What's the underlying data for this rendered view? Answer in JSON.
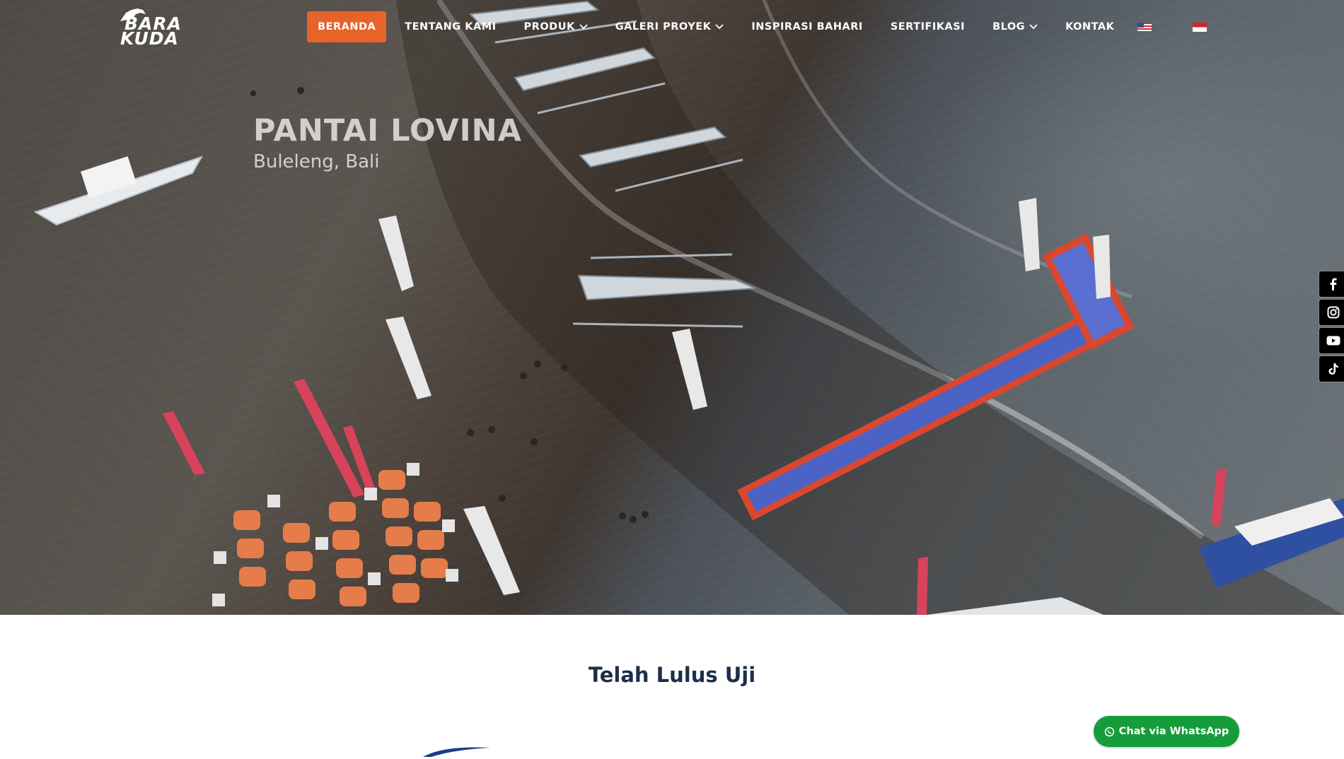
{
  "brand": {
    "logo_line1": "BARA",
    "logo_line2": "KUDA"
  },
  "nav": {
    "items": [
      {
        "label": "BERANDA",
        "active": true
      },
      {
        "label": "TENTANG KAMI"
      },
      {
        "label": "PRODUK",
        "dropdown": true
      },
      {
        "label": "GALERI PROYEK",
        "dropdown": true
      },
      {
        "label": "INSPIRASI BAHARI"
      },
      {
        "label": "SERTIFIKASI"
      },
      {
        "label": "BLOG",
        "dropdown": true
      },
      {
        "label": "KONTAK"
      }
    ],
    "languages": [
      "en-flag-icon",
      "id-flag-icon"
    ],
    "active_color": "#e8632a"
  },
  "hero": {
    "place": "PANTAI LOVINA",
    "region": "Buleleng, Bali"
  },
  "social": {
    "icons": [
      "facebook-icon",
      "instagram-icon",
      "youtube-icon",
      "tiktok-icon"
    ]
  },
  "section": {
    "title": "Telah Lulus Uji"
  },
  "whatsapp": {
    "label": "Chat via WhatsApp",
    "color": "#169c3a"
  }
}
